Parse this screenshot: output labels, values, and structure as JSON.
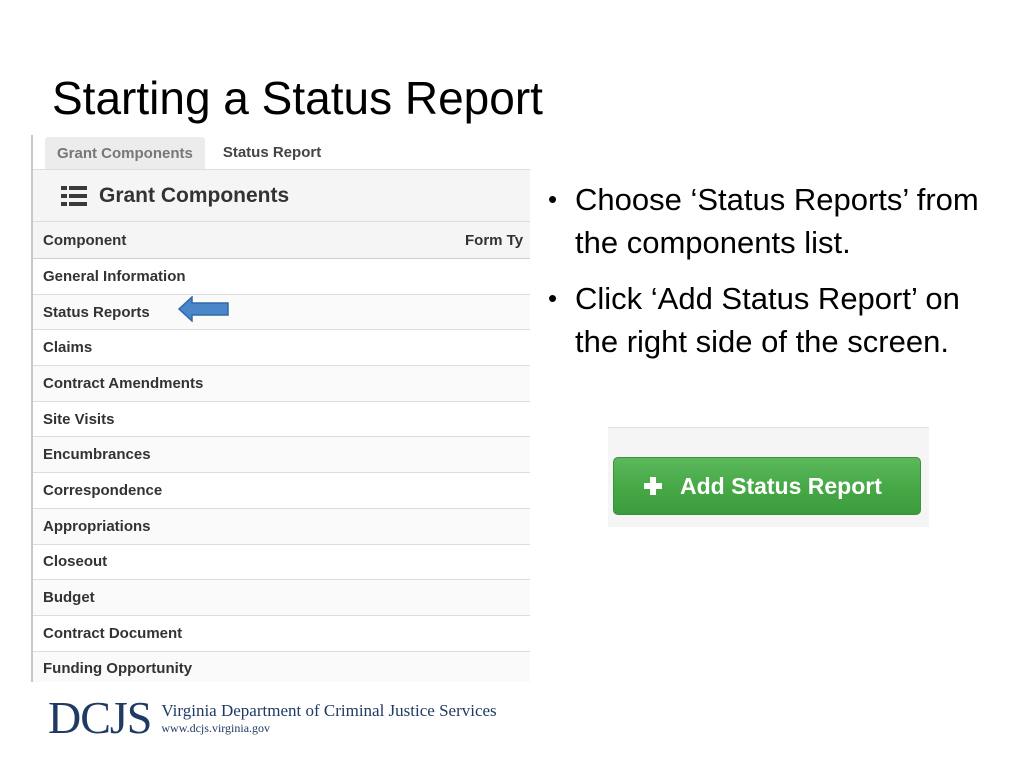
{
  "slide": {
    "title": "Starting a Status Report"
  },
  "screenshot": {
    "tabs": [
      {
        "label": "Grant Components"
      },
      {
        "label": "Status Report"
      }
    ],
    "heading": "Grant Components",
    "columns": {
      "component": "Component",
      "form_type": "Form Ty"
    },
    "rows": [
      "General Information",
      "Status Reports",
      "Claims",
      "Contract Amendments",
      "Site Visits",
      "Encumbrances",
      "Correspondence",
      "Appropriations",
      "Closeout",
      "Budget",
      "Contract Document",
      "Funding Opportunity"
    ]
  },
  "bullets": [
    " Choose ‘Status Reports’ from the components list.",
    "Click ‘Add Status Report’ on the right side of the screen."
  ],
  "add_button": {
    "label": "Add Status Report",
    "color": "#4cae4c"
  },
  "footer": {
    "logo_mark": "DCJS",
    "org_name": "Virginia Department of Criminal Justice Services",
    "url": "www.dcjs.virginia.gov"
  },
  "icons": {
    "heading_icon": "list-icon",
    "pointer": "arrow-left-icon",
    "button_icon": "plus-icon"
  },
  "colors": {
    "arrow": "#4a86c8"
  }
}
